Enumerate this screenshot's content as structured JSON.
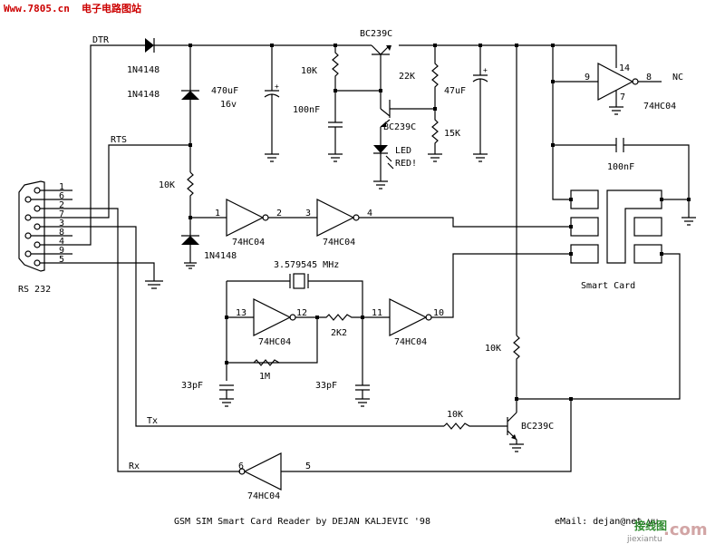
{
  "header": {
    "site_url": "Www.7805.cn",
    "site_name": "电子电路图站"
  },
  "signals": {
    "dtr": "DTR",
    "rts": "RTS",
    "tx": "Tx",
    "rx": "Rx",
    "nc": "NC"
  },
  "connector": {
    "label": "RS 232",
    "pins": [
      "1",
      "6",
      "2",
      "7",
      "3",
      "8",
      "4",
      "9",
      "5"
    ]
  },
  "components": {
    "d1": "1N4148",
    "d2": "1N4148",
    "d3": "1N4148",
    "c_bulk": "470uF",
    "c_bulk_v": "16v",
    "r_bias": "10K",
    "c_bias": "100nF",
    "q1": "BC239C",
    "q2": "BC239C",
    "q3": "BC239C",
    "r_22k": "22K",
    "r_15k": "15K",
    "c_47u": "47uF",
    "led_line1": "LED",
    "led_line2": "RED!",
    "r_rts": "10K",
    "ic": "74HC04",
    "crystal": "3.579545 MHz",
    "r_2k2": "2K2",
    "r_1m": "1M",
    "c_33p_a": "33pF",
    "c_33p_b": "33pF",
    "r_pullup": "10K",
    "r_tx": "10K",
    "c_decouple": "100nF",
    "smart_card": "Smart Card"
  },
  "pins": {
    "p1": "1",
    "p2": "2",
    "p3": "3",
    "p4": "4",
    "p5": "5",
    "p6": "6",
    "p7": "7",
    "p8": "8",
    "p9": "9",
    "p10": "10",
    "p11": "11",
    "p12": "12",
    "p13": "13",
    "p14": "14"
  },
  "footer": {
    "title": "GSM SIM Smart Card Reader by DEJAN KALJEVIC '98",
    "email": "eMail: dejan@net.yu"
  },
  "watermark": {
    "cn": "接线图",
    "com": ".com",
    "pinyin": "jiexiantu"
  }
}
